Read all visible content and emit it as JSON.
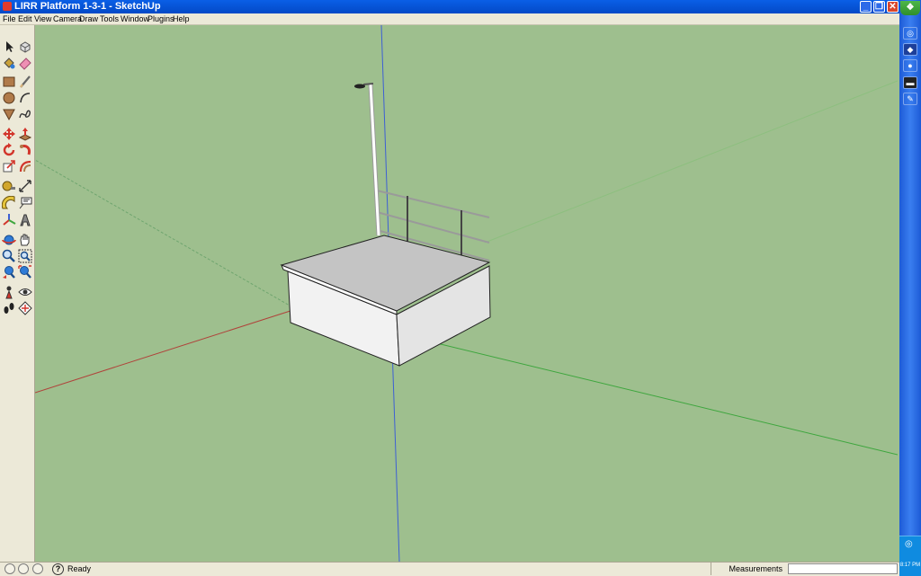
{
  "window": {
    "title": "LIRR Platform 1-3-1 - SketchUp",
    "minimize": "_",
    "maximize": "❐",
    "close": "✕"
  },
  "menu": {
    "items": [
      "File",
      "Edit",
      "View",
      "Camera",
      "Draw",
      "Tools",
      "Window",
      "Plugins",
      "Help"
    ]
  },
  "toolbar": {
    "tools": [
      "select",
      "make-component",
      "paint-bucket",
      "eraser",
      "rectangle",
      "line",
      "circle",
      "arc",
      "polygon",
      "freehand",
      "move",
      "push-pull",
      "rotate",
      "follow-me",
      "scale",
      "offset",
      "tape-measure",
      "dimension",
      "protractor",
      "text",
      "axes",
      "3d-text",
      "orbit",
      "pan",
      "zoom",
      "zoom-window",
      "previous-view",
      "zoom-extents",
      "position-camera",
      "look-around",
      "walk",
      "section-plane"
    ]
  },
  "status": {
    "help": "?",
    "text": "Ready",
    "measurements_label": "Measurements",
    "measurements_value": ""
  },
  "taskbar": {
    "start": "❖",
    "clock": "8:17 PM"
  },
  "colors": {
    "sky_ground": "#9ebf8e",
    "axis_red": "#b0423a",
    "axis_green": "#3ea63e",
    "axis_blue": "#3d5fd4",
    "titlebar": "#0349c7"
  }
}
